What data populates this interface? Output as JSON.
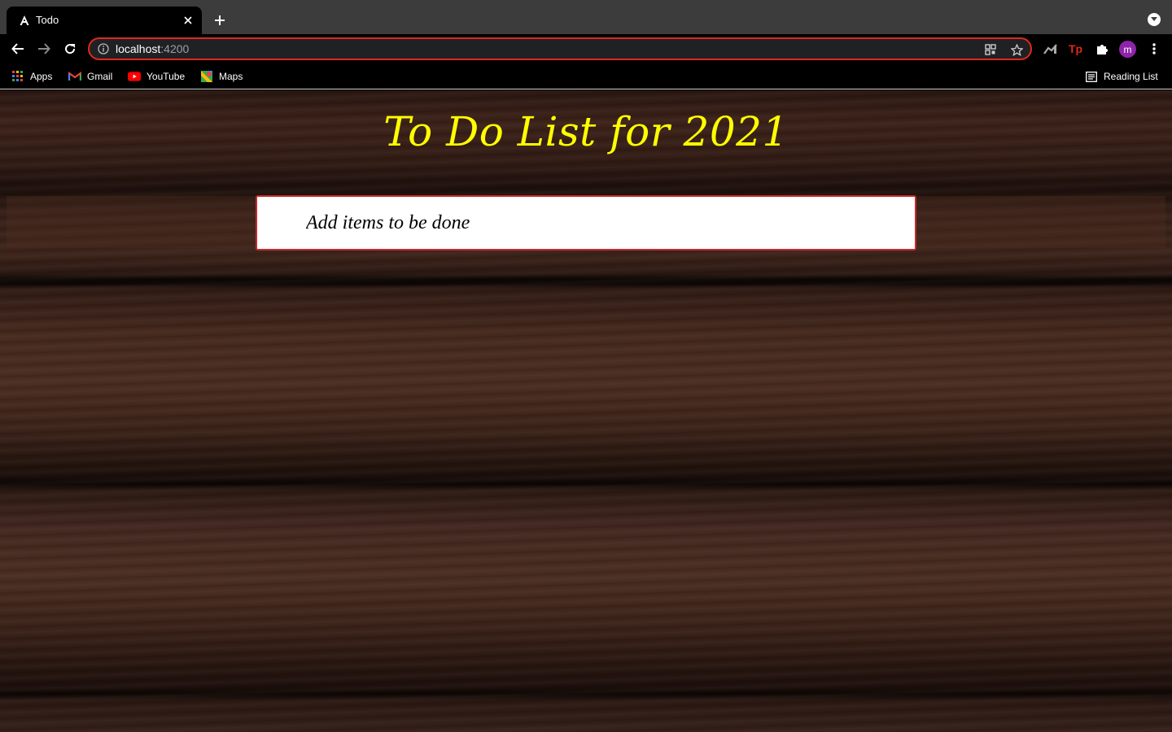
{
  "browser": {
    "tab": {
      "title": "Todo",
      "favicon": "angular-icon"
    },
    "address_bar": {
      "host": "localhost",
      "port": ":4200"
    },
    "bookmarks": [
      {
        "label": "Apps",
        "icon": "apps-grid-icon"
      },
      {
        "label": "Gmail",
        "icon": "gmail-icon"
      },
      {
        "label": "YouTube",
        "icon": "youtube-icon"
      },
      {
        "label": "Maps",
        "icon": "maps-icon"
      }
    ],
    "reading_list": {
      "label": "Reading List",
      "icon": "reading-list-icon"
    },
    "profile_initial": "m",
    "accent_color": "#e0281e"
  },
  "page": {
    "heading": "To Do List for 2021",
    "input": {
      "placeholder": "Add items to be done",
      "value": ""
    },
    "heading_color": "#ffff00",
    "input_border_color": "#c52a2a"
  }
}
